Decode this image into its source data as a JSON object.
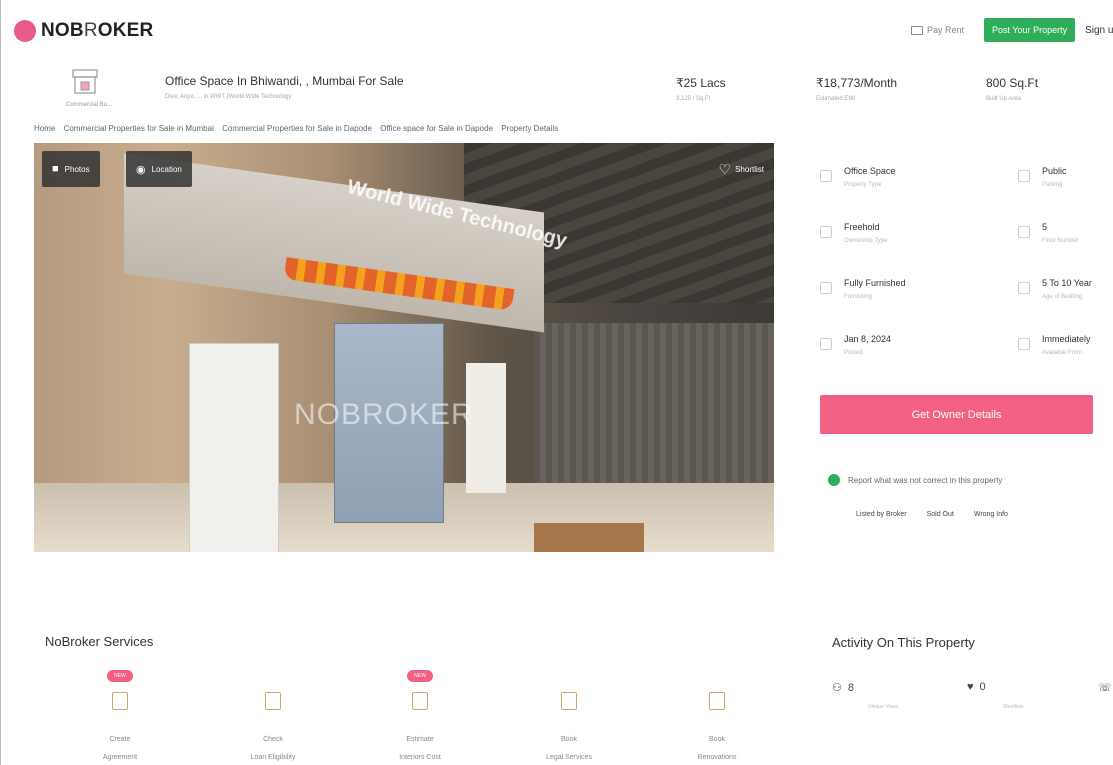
{
  "header": {
    "brand_bold": "NOB",
    "brand_o": "R",
    "brand_rest": "OKER",
    "pay_rent": "Pay Rent",
    "post_property": "Post Your Property",
    "sign_up": "Sign up"
  },
  "property": {
    "category": "Commercial Bu...",
    "title": "Office Space In Bhiwandi, , Mumbai For Sale",
    "subtitle": "Dive, Anjur, ... in WWT (World Wide Technology",
    "price": "₹25 Lacs",
    "price_sub": "3,125 / Sq.Ft",
    "emi": "₹18,773/Month",
    "emi_sub": "Estimated EMI",
    "area": "800 Sq.Ft",
    "area_sub": "Built Up Area"
  },
  "breadcrumb": [
    "Home",
    "Commercial Properties for Sale in Mumbai",
    "Commercial Properties for Sale in Dapode",
    "Office space for Sale in Dapode",
    "Property Details"
  ],
  "gallery": {
    "photos_label": "Photos",
    "location_label": "Location",
    "shortlist_label": "Shortlist",
    "watermark": "NOBROKER",
    "brand_text": "World Wide Technology"
  },
  "details": [
    {
      "value": "Office Space",
      "sub": "Property Type",
      "icon": "building-icon"
    },
    {
      "value": "Public",
      "sub": "Parking",
      "icon": "parking-icon"
    },
    {
      "value": "Freehold",
      "sub": "Ownership Type",
      "icon": "key-icon"
    },
    {
      "value": "5",
      "sub": "Floor Number",
      "icon": "floor-icon"
    },
    {
      "value": "Fully Furnished",
      "sub": "Furnishing",
      "icon": "sofa-icon"
    },
    {
      "value": "5 To 10 Year",
      "sub": "Age of Building",
      "icon": "calendar-icon"
    },
    {
      "value": "Jan 8, 2024",
      "sub": "Posted",
      "icon": "flag-icon"
    },
    {
      "value": "Immediately",
      "sub": "Available From",
      "icon": "clock-icon"
    }
  ],
  "owner_button": "Get Owner Details",
  "report": {
    "text": "Report what was not correct in this property",
    "links": [
      "Listed by Broker",
      "Sold Out",
      "Wrong Info"
    ]
  },
  "services": {
    "title": "NoBroker Services",
    "items": [
      {
        "badge": "NEW",
        "line1": "Create",
        "line2": "Agreement",
        "icon": "agreement-icon"
      },
      {
        "badge": "",
        "line1": "Check",
        "line2": "Loan Eligibility",
        "icon": "loan-icon"
      },
      {
        "badge": "NEW",
        "line1": "Estimate",
        "line2": "Interiors Cost",
        "icon": "interiors-icon"
      },
      {
        "badge": "",
        "line1": "Book",
        "line2": "Legal Services",
        "icon": "legal-icon"
      },
      {
        "badge": "",
        "line1": "Book",
        "line2": "Renovations",
        "icon": "renovation-icon"
      }
    ]
  },
  "activity": {
    "title": "Activity On This Property",
    "views": "8",
    "views_sub": "Unique Views",
    "shortlists": "0",
    "shortlists_sub": "Shortlists"
  },
  "colors": {
    "brand_pink": "#f26083",
    "brand_green": "#2fae5a"
  }
}
